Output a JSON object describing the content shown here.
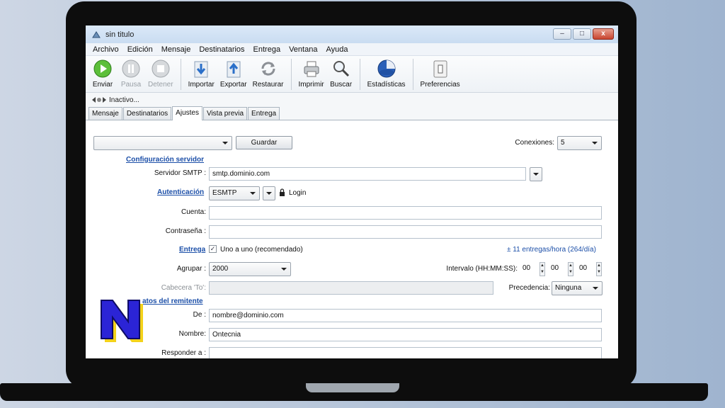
{
  "window": {
    "title": "sin titulo",
    "controls": {
      "minimize": "–",
      "maximize": "□",
      "close": "x"
    }
  },
  "menu": [
    "Archivo",
    "Edición",
    "Mensaje",
    "Destinatarios",
    "Entrega",
    "Ventana",
    "Ayuda"
  ],
  "toolbar": {
    "groups": [
      [
        {
          "label": "Enviar",
          "icon": "play-icon",
          "enabled": true
        },
        {
          "label": "Pausa",
          "icon": "pause-icon",
          "enabled": false
        },
        {
          "label": "Detener",
          "icon": "stop-icon",
          "enabled": false
        }
      ],
      [
        {
          "label": "Importar",
          "icon": "import-icon",
          "enabled": true
        },
        {
          "label": "Exportar",
          "icon": "export-icon",
          "enabled": true
        },
        {
          "label": "Restaurar",
          "icon": "restore-icon",
          "enabled": true
        }
      ],
      [
        {
          "label": "Imprimir",
          "icon": "printer-icon",
          "enabled": true
        },
        {
          "label": "Buscar",
          "icon": "search-icon",
          "enabled": true
        }
      ],
      [
        {
          "label": "Estadísticas",
          "icon": "statistics-icon",
          "enabled": true
        }
      ],
      [
        {
          "label": "Preferencias",
          "icon": "preferences-icon",
          "enabled": true
        }
      ]
    ]
  },
  "status": {
    "text": "Inactivo..."
  },
  "tabs": [
    {
      "label": "Mensaje",
      "active": false
    },
    {
      "label": "Destinatarios",
      "active": false
    },
    {
      "label": "Ajustes",
      "active": true
    },
    {
      "label": "Vista previa",
      "active": false
    },
    {
      "label": "Entrega",
      "active": false
    }
  ],
  "settings": {
    "profile_value": "",
    "save_label": "Guardar",
    "connections_label": "Conexiones:",
    "connections_value": "5",
    "server_section_title": "Configuración servidor",
    "smtp_label": "Servidor SMTP :",
    "smtp_value": "smtp.dominio.com",
    "auth_link": "Autenticación",
    "auth_value": "ESMTP",
    "login_label": "Login",
    "account_label": "Cuenta:",
    "account_value": "",
    "password_label": "Contraseña :",
    "password_value": "",
    "delivery_link": "Entrega",
    "one_by_one_label": "Uno a uno (recomendado)",
    "one_by_one_checked": true,
    "rate_text": "± 11 entregas/hora (264/día)",
    "group_label": "Agrupar :",
    "group_value": "2000",
    "interval_label": "Intervalo (HH:MM:SS):",
    "interval_hh": "00",
    "interval_mm": "00",
    "interval_ss": "00",
    "to_header_label": "Cabecera 'To':",
    "to_header_value": "",
    "precedence_label": "Precedencia:",
    "precedence_value": "Ninguna",
    "sender_section_title": "atos del remitente",
    "from_label": "De :",
    "from_value": "nombre@dominio.com",
    "name_label": "Nombre:",
    "name_value": "Ontecnia",
    "reply_label": "Responder a :",
    "reply_value": ""
  },
  "colors": {
    "link": "#1c4fa8",
    "logo_fill": "#2b24d6",
    "logo_shadow": "#f3d21a"
  }
}
